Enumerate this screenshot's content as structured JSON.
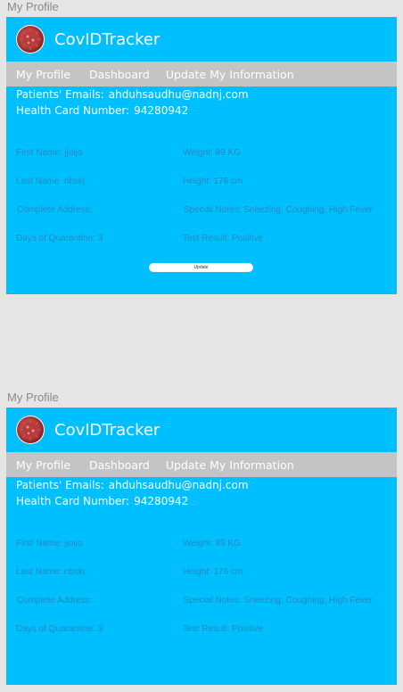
{
  "screens": [
    {
      "frame_label": "My Profile",
      "app_title": "CovIDTracker",
      "nav": [
        "My Profile",
        "Dashboard",
        "Update My Information"
      ],
      "emails_label": "Patients' Emails:",
      "emails_value": "ahduhsaudhu@nadnj.com",
      "health_card_label": "Health Card Number:",
      "health_card_value": "94280942",
      "fields": {
        "first_name": "First Name: jjoijo",
        "weight": "Weight: 89 KG",
        "last_name": "Last Name: nbskj",
        "height": "Height: 176 cm",
        "address": "Complete Address:",
        "notes": "Special Notes: Sneezing, Coughing, High Fever",
        "quarantine": "Days of Quarantine: 3",
        "test_result": "Test Result: Positive"
      },
      "update_button": "Update"
    },
    {
      "frame_label": "My Profile",
      "app_title": "CovIDTracker",
      "nav": [
        "My Profile",
        "Dashboard",
        "Update My Information"
      ],
      "emails_label": "Patients' Emails:",
      "emails_value": "ahduhsaudhu@nadnj.com",
      "health_card_label": "Health Card Number:",
      "health_card_value": "94280942",
      "fields": {
        "first_name": "First Name: jjoijo",
        "weight": "Weight: 89 KG",
        "last_name": "Last Name: nbskj",
        "height": "Height: 176 cm",
        "address": "Complete Address:",
        "notes": "Special Notes: Sneezing, Coughing, High Fever",
        "quarantine": "Days of Quarantine: 3",
        "test_result": "Test Result: Positive"
      }
    }
  ],
  "colors": {
    "frame_bg": "#00bfff",
    "navbar_bg": "#c4c4c4",
    "canvas_bg": "#e5e5e5",
    "field_text": "#2f7fb0"
  },
  "icons": {
    "logo": "coronavirus-icon"
  }
}
